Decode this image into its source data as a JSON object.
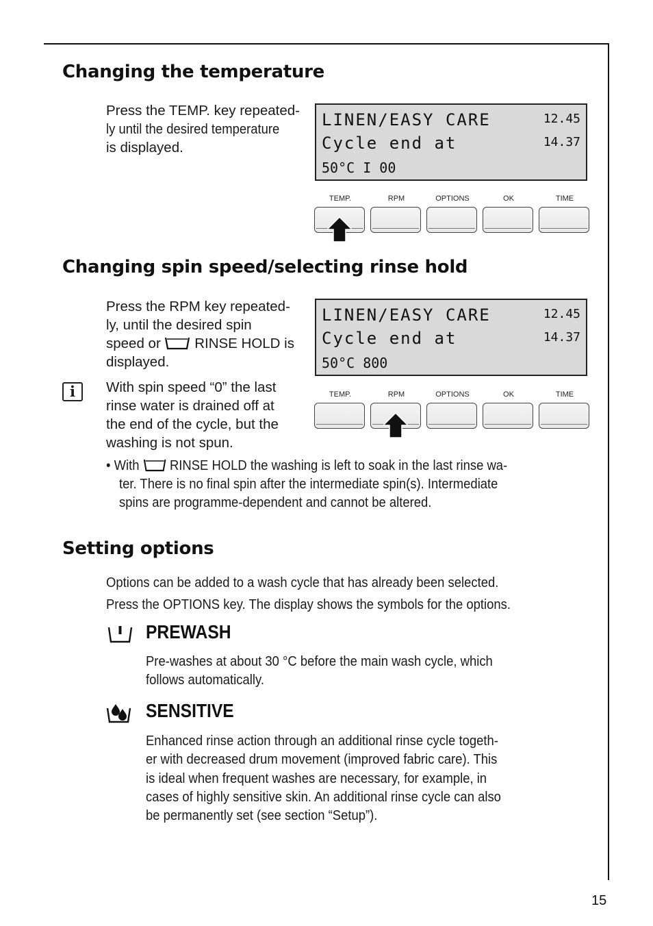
{
  "page": {
    "number": "15"
  },
  "sections": {
    "temperature": {
      "heading": "Changing the temperature",
      "lines": [
        "Press the TEMP. key repeated-",
        "ly until the desired temperature",
        "is displayed."
      ],
      "display": {
        "line1": "LINEN/EASY CARE",
        "line1_right": "12.45",
        "line2": "Cycle end at",
        "line2_right": "14.37",
        "line3": "50°C I 00"
      },
      "pressed_key": "TEMP."
    },
    "spin": {
      "heading": "Changing spin speed/selecting rinse hold",
      "lines": [
        "Press the RPM key repeated-",
        "ly, until the desired spin",
        "speed or",
        "RINSE HOLD is",
        "displayed."
      ],
      "info_icon": "info-icon",
      "info_lines": [
        "With spin speed “0” the last",
        "rinse water is drained off at",
        "the end of the cycle, but the",
        "washing is not spun."
      ],
      "bullet_prefix": "• With",
      "bullet_line1_rest": "RINSE HOLD the washing is left to soak in the last rinse wa-",
      "bullet_line2": "ter. There is no final spin after the intermediate spin(s). Intermediate",
      "bullet_line3": "spins are programme-dependent and cannot be altered.",
      "display": {
        "line1": "LINEN/EASY CARE",
        "line1_right": "12.45",
        "line2": "Cycle end at",
        "line2_right": "14.37",
        "line3": "50°C 800"
      },
      "pressed_key": "RPM"
    },
    "options": {
      "heading": "Setting options",
      "intro1": "Options can be added to a wash cycle that has already been selected.",
      "intro2": "Press the OPTIONS key. The display shows the symbols for the options.",
      "prewash": {
        "icon": "prewash-tub-icon",
        "title": "PREWASH",
        "lines": [
          "Pre-washes at about 30 °C before the main wash cycle, which",
          "follows automatically."
        ]
      },
      "sensitive": {
        "icon": "sensitive-drops-icon",
        "title": "SENSITIVE",
        "lines": [
          "Enhanced rinse action through an additional rinse cycle togeth-",
          "er with decreased drum movement (improved fabric care).  This",
          "is ideal when frequent washes are necessary, for example, in",
          "cases of highly sensitive skin. An additional rinse cycle can also",
          "be permanently set (see section “Setup”)."
        ]
      }
    }
  },
  "keypad": {
    "keys": [
      "TEMP.",
      "RPM",
      "OPTIONS",
      "OK",
      "TIME"
    ]
  }
}
